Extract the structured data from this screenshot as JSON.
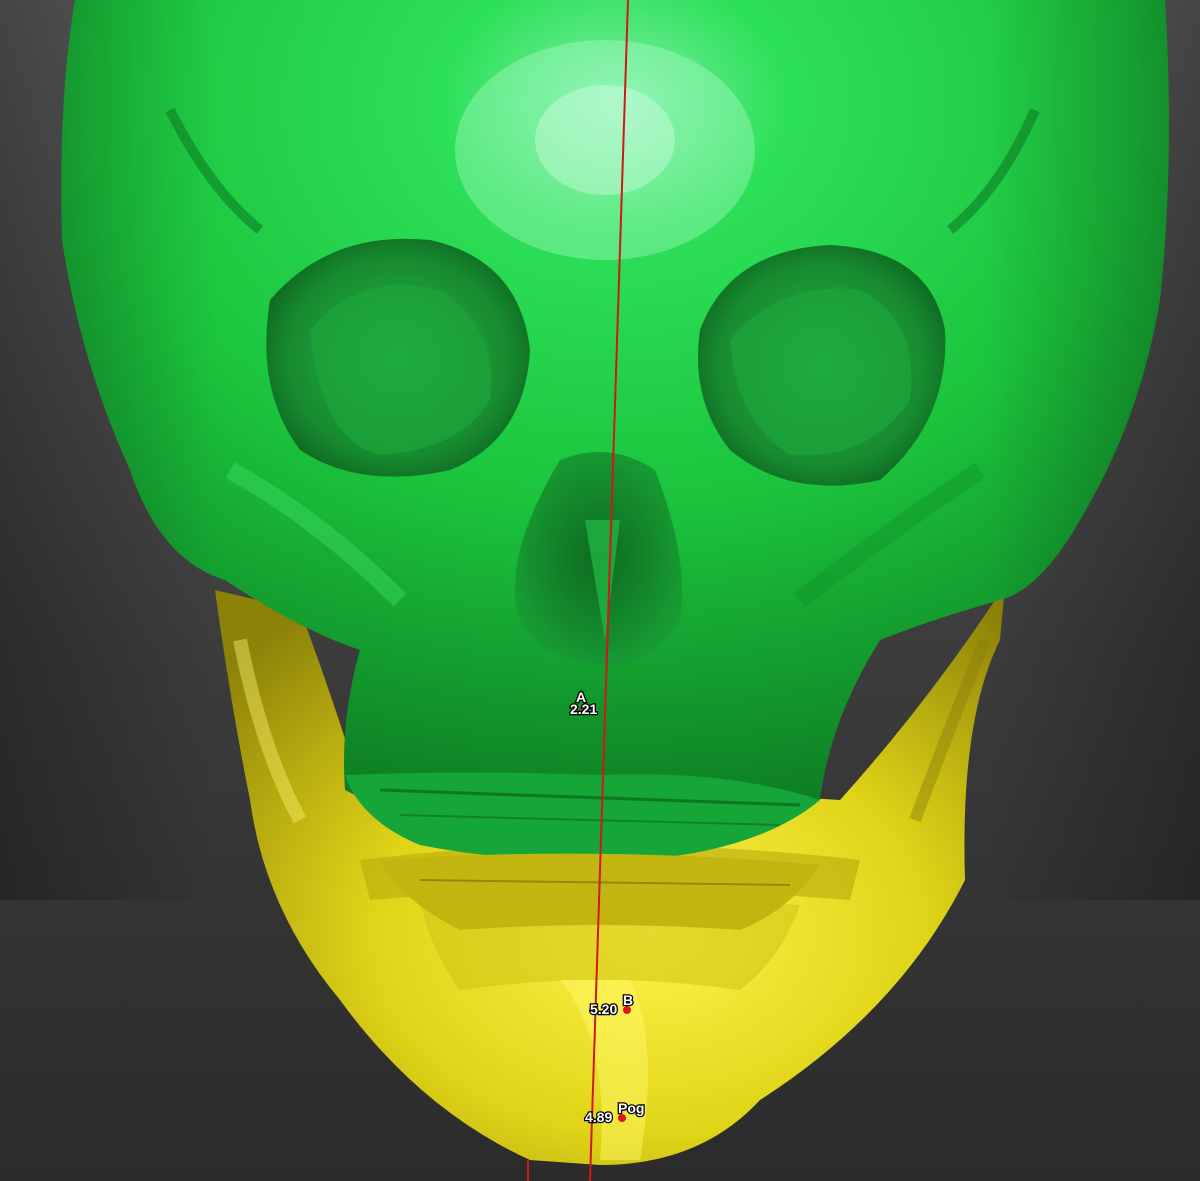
{
  "scene": {
    "skull_color": "#1ed63a",
    "mandible_color": "#e6d816",
    "midline_color": "#d01818",
    "landmark_color": "#e01414"
  },
  "landmarks": [
    {
      "name": "A",
      "value": "2.21"
    },
    {
      "name": "B",
      "value": "5.20"
    },
    {
      "name": "Pog",
      "value": "4.89"
    }
  ]
}
